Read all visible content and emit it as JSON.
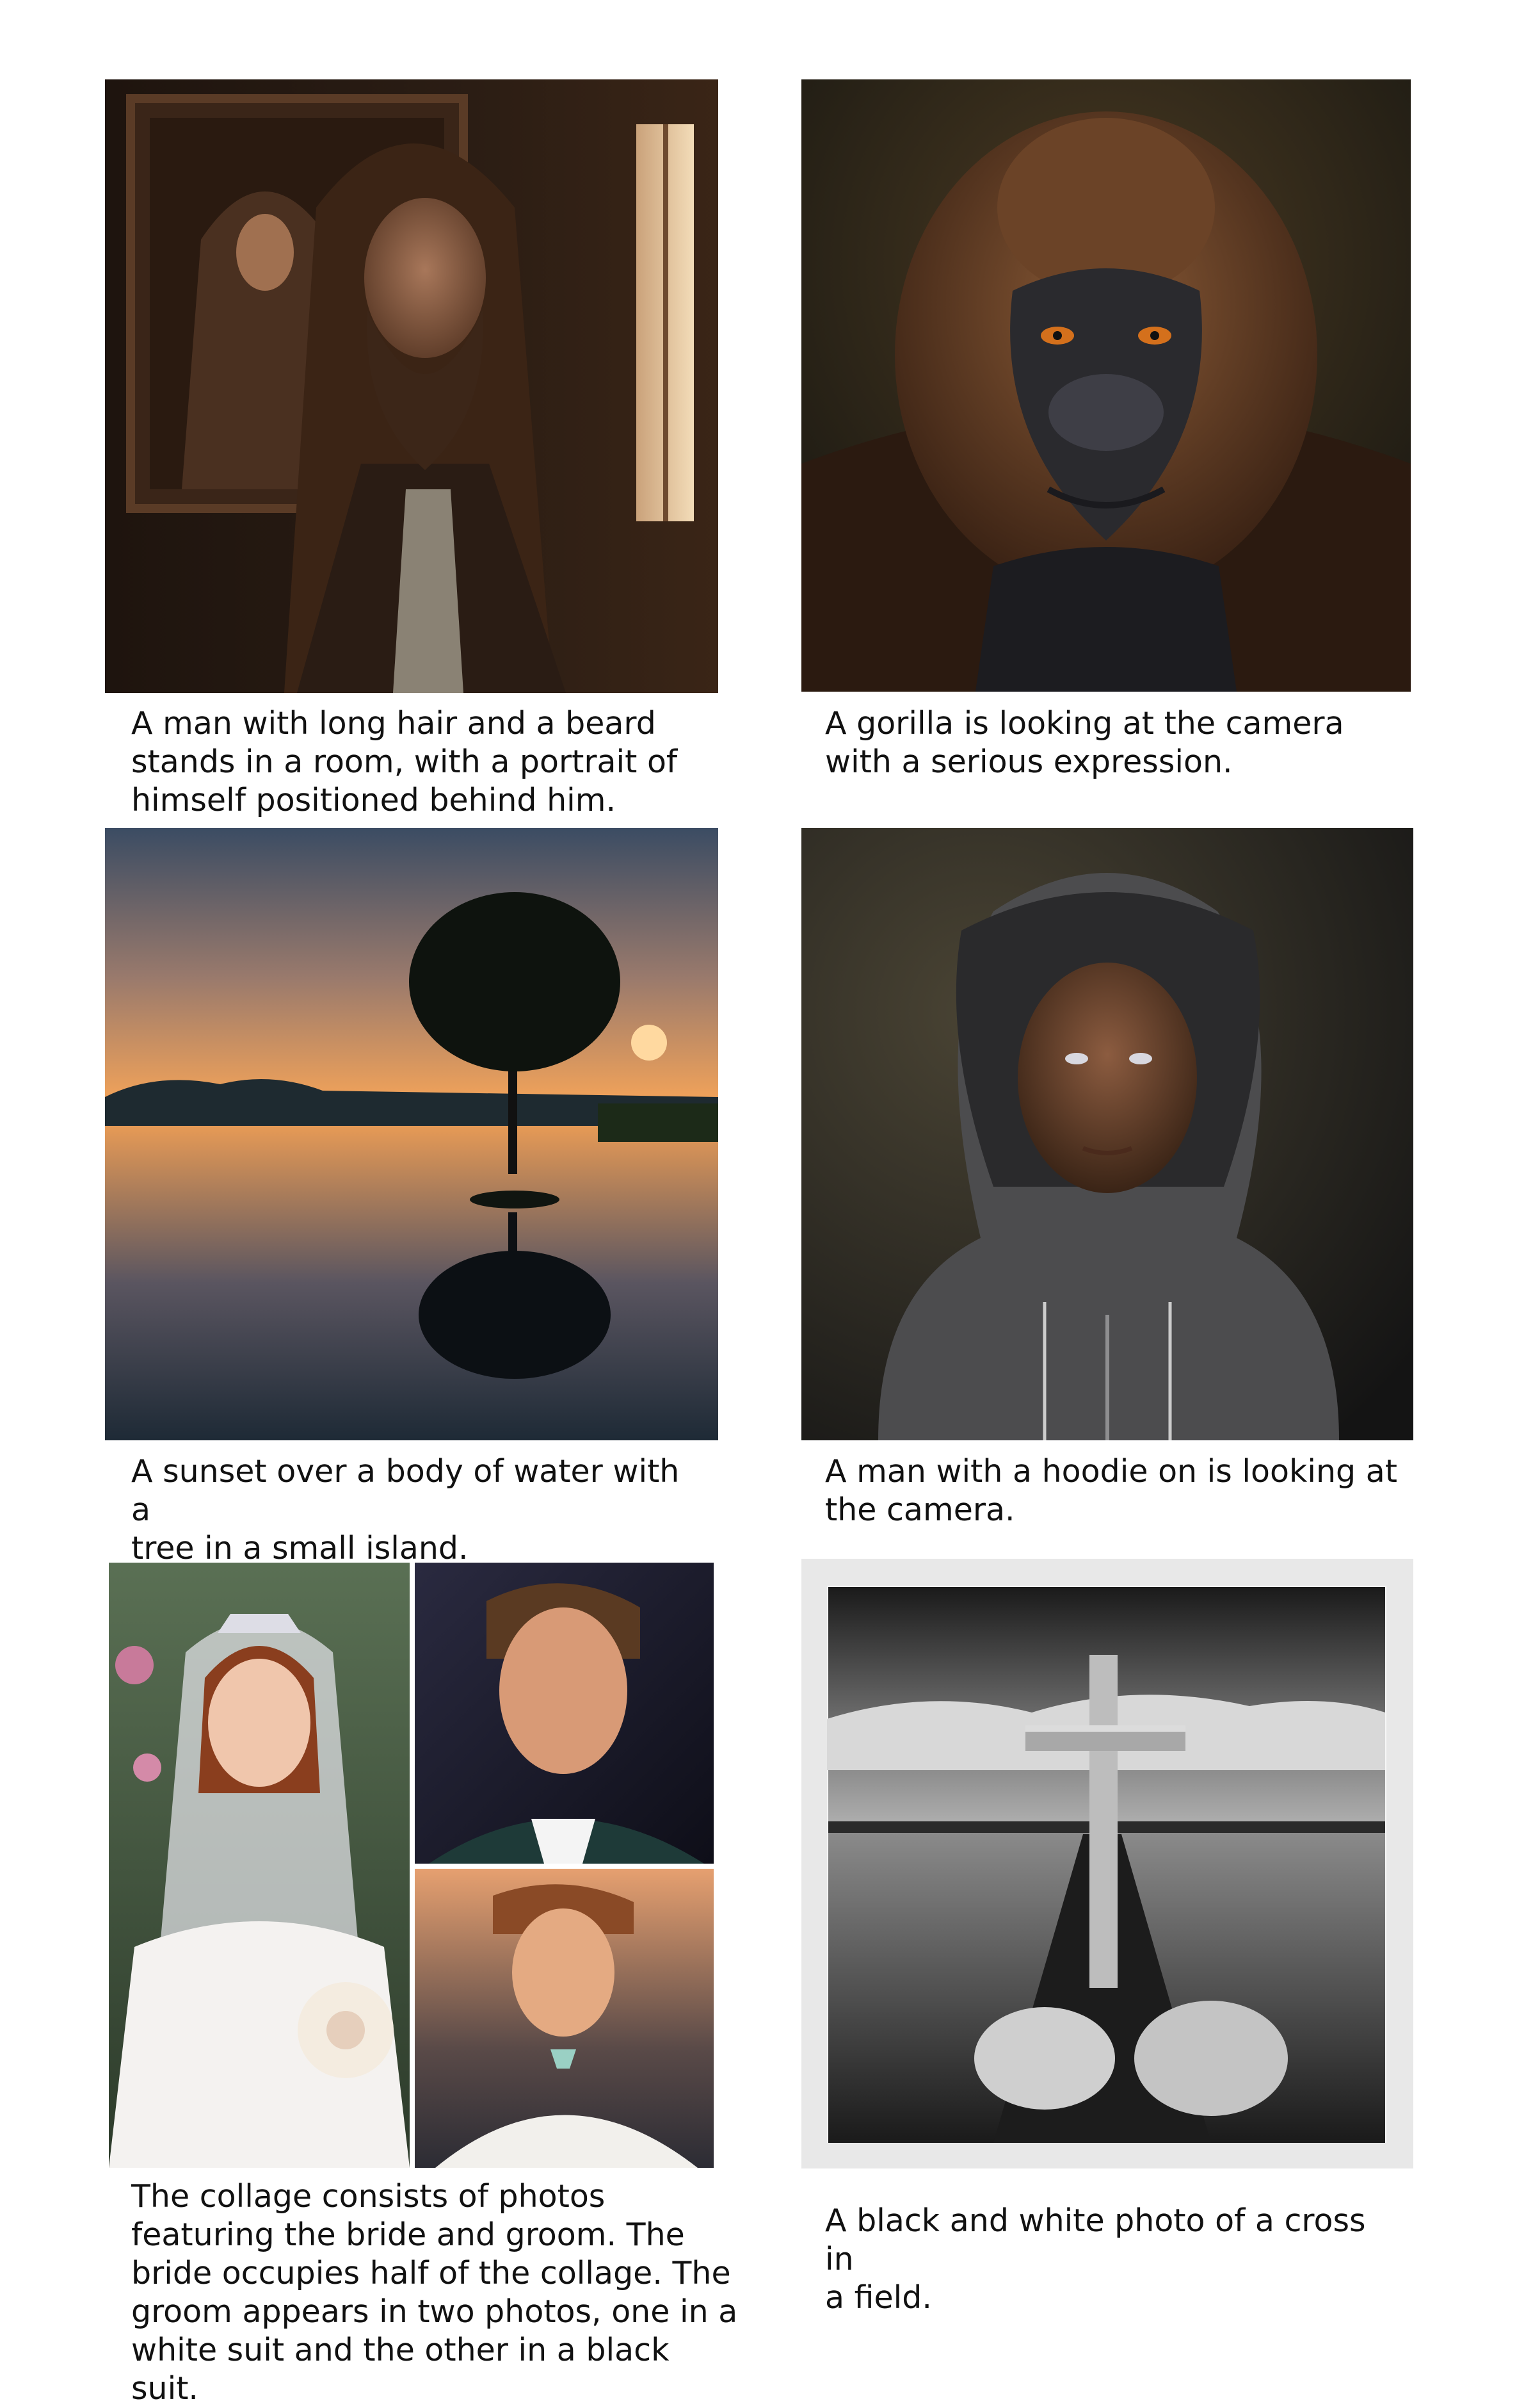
{
  "captions": {
    "man_long_hair": "A man with long hair and a beard\nstands in a room, with a portrait of\nhimself positioned behind him.",
    "gorilla": "A gorilla is looking at the camera\nwith a serious expression.",
    "sunset": "A sunset over a body of water with a\ntree in a small island.",
    "hoodie": "A man with a hoodie on is looking at\nthe camera.",
    "collage": "The collage consists of photos\nfeaturing the bride and groom. The\nbride occupies half of the collage. The\ngroom appears in two photos, one in a\nwhite suit and the other in a black suit.",
    "cross": "A black and white photo of a cross in\na field."
  }
}
